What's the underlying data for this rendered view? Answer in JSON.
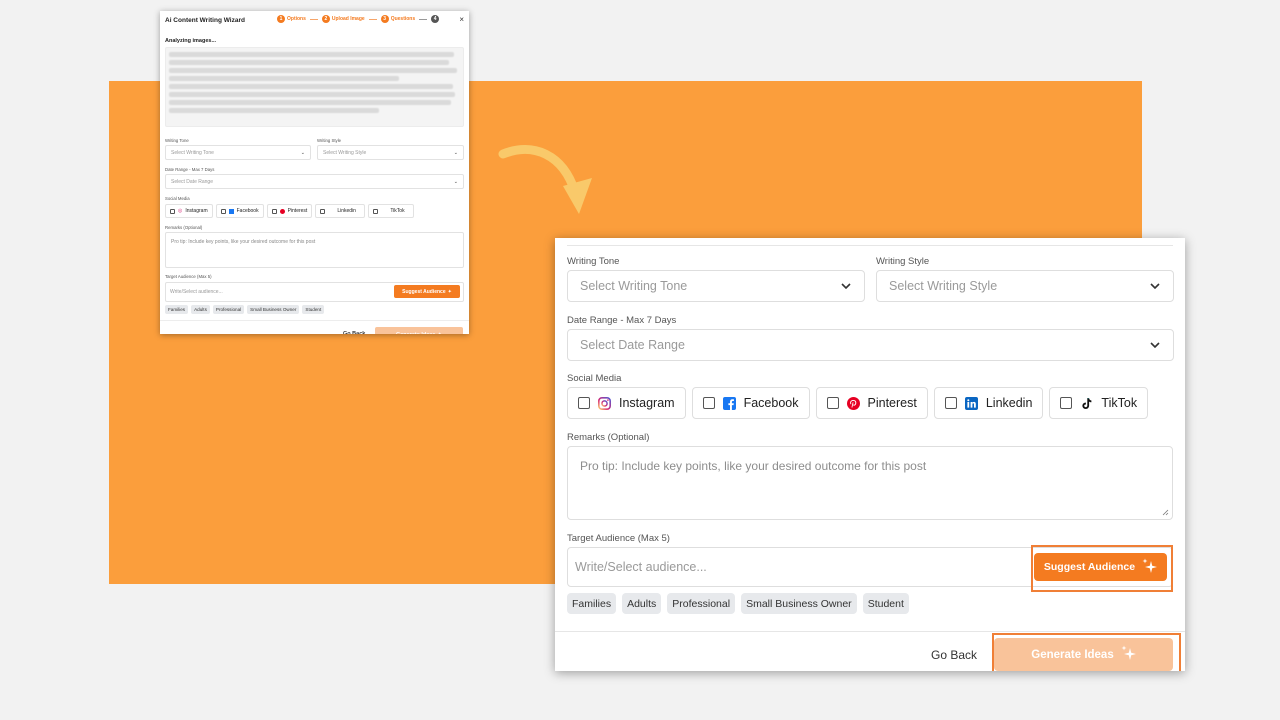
{
  "wizard": {
    "title": "Ai Content Writing Wizard",
    "steps": [
      {
        "number": "1",
        "label": "Options"
      },
      {
        "number": "2",
        "label": "Upload Image"
      },
      {
        "number": "3",
        "label": "Questions"
      },
      {
        "number": "4",
        "label": ""
      }
    ],
    "close": "×",
    "analyzing": "Analyzing images..."
  },
  "form": {
    "writing_tone": {
      "label": "Writing Tone",
      "placeholder": "Select Writing Tone"
    },
    "writing_style": {
      "label": "Writing Style",
      "placeholder": "Select Writing Style"
    },
    "date_range": {
      "label": "Date Range - Max 7 Days",
      "placeholder": "Select Date Range"
    },
    "social_media": {
      "label": "Social Media",
      "options": [
        {
          "name": "Instagram",
          "icon": "instagram-icon"
        },
        {
          "name": "Facebook",
          "icon": "facebook-icon"
        },
        {
          "name": "Pinterest",
          "icon": "pinterest-icon"
        },
        {
          "name": "Linkedin",
          "icon": "linkedin-icon"
        },
        {
          "name": "TikTok",
          "icon": "tiktok-icon"
        }
      ]
    },
    "remarks": {
      "label": "Remarks (Optional)",
      "placeholder": "Pro tip: Include key points, like your desired outcome for this post"
    },
    "target_audience": {
      "label": "Target Audience (Max 5)",
      "placeholder": "Write/Select audience...",
      "suggest_label": "Suggest Audience",
      "tags": [
        "Families",
        "Adults",
        "Professional",
        "Small Business Owner",
        "Student"
      ]
    }
  },
  "footer": {
    "go_back": "Go Back",
    "generate": "Generate Ideas"
  },
  "colors": {
    "accent": "#f47b20",
    "accent_light": "#f9c39a",
    "background_block": "#fb9e3c",
    "arrow": "#f9c96a"
  }
}
